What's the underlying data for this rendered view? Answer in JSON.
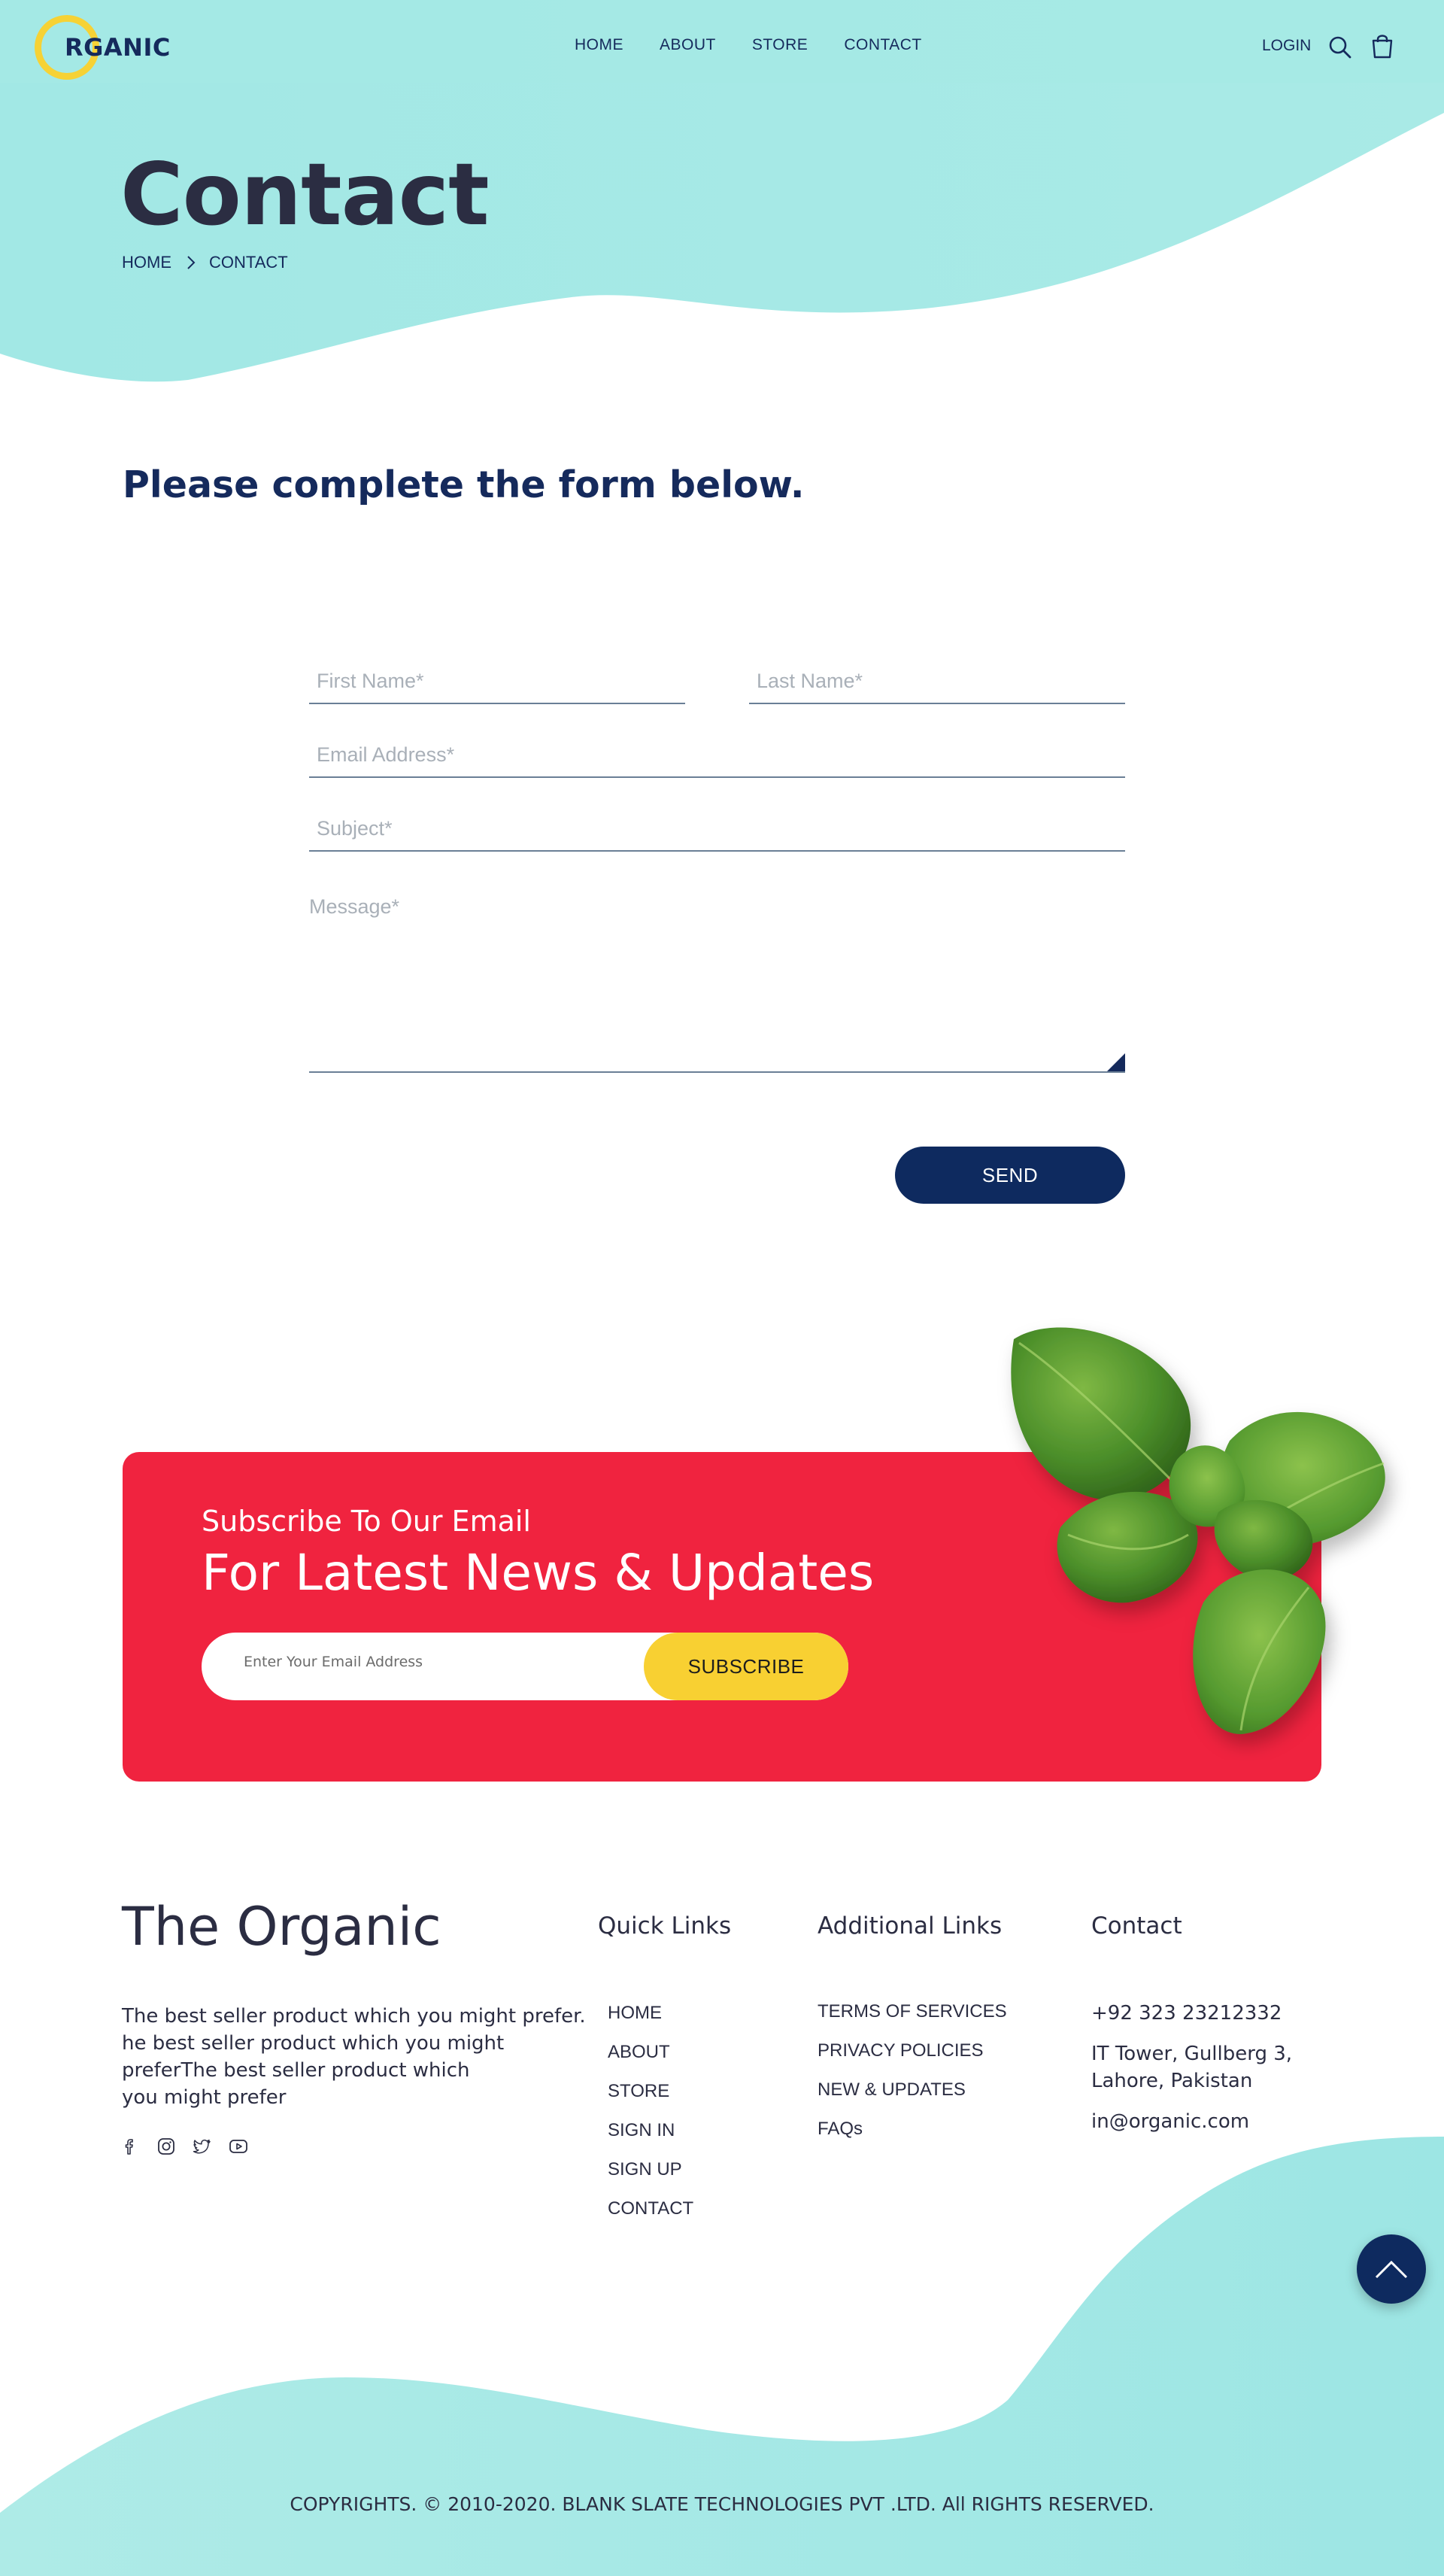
{
  "header": {
    "logo_text": "RGANIC",
    "nav": [
      "HOME",
      "ABOUT",
      "STORE",
      "CONTACT"
    ],
    "login_label": "LOGIN"
  },
  "hero": {
    "title": "Contact",
    "breadcrumb": [
      "HOME",
      "CONTACT"
    ]
  },
  "form": {
    "heading": "Please complete the form below.",
    "first_name_placeholder": "First Name*",
    "last_name_placeholder": "Last Name*",
    "email_placeholder": "Email Address*",
    "subject_placeholder": "Subject*",
    "message_placeholder": "Message*",
    "send_label": "SEND"
  },
  "subscribe": {
    "subtitle": "Subscribe To Our Email",
    "title": "For Latest News & Updates",
    "email_placeholder": "Enter Your Email Address",
    "button_label": "SUBSCRIBE"
  },
  "footer": {
    "brand": "The Organic",
    "description_lines": [
      "The best seller product which you might prefer.",
      "he best seller product which you might",
      "preferThe best seller product which",
      "you might prefer"
    ],
    "social_icons": [
      "facebook-icon",
      "instagram-icon",
      "twitter-icon",
      "youtube-icon"
    ],
    "quick_links": {
      "heading": "Quick Links",
      "items": [
        "HOME",
        "ABOUT",
        "STORE",
        "SIGN IN",
        "SIGN UP",
        "CONTACT"
      ]
    },
    "additional_links": {
      "heading": "Additional Links",
      "items": [
        "TERMS OF SERVICES",
        "PRIVACY POLICIES",
        "NEW & UPDATES",
        "FAQs"
      ]
    },
    "contact": {
      "heading": "Contact",
      "phone": "+92 323 23212332",
      "address_line1": "IT Tower, Gullberg 3,",
      "address_line2": "Lahore, Pakistan",
      "email": "in@organic.com"
    },
    "copyright": "COPYRIGHTS. © 2010-2020. BLANK SLATE TECHNOLOGIES PVT .LTD. All RIGHTS RESERVED."
  },
  "colors": {
    "aqua": "#a5eae6",
    "navy": "#0e2a5f",
    "red": "#f0233f",
    "yellow": "#f8d032",
    "text_dark": "#2b2d42"
  }
}
